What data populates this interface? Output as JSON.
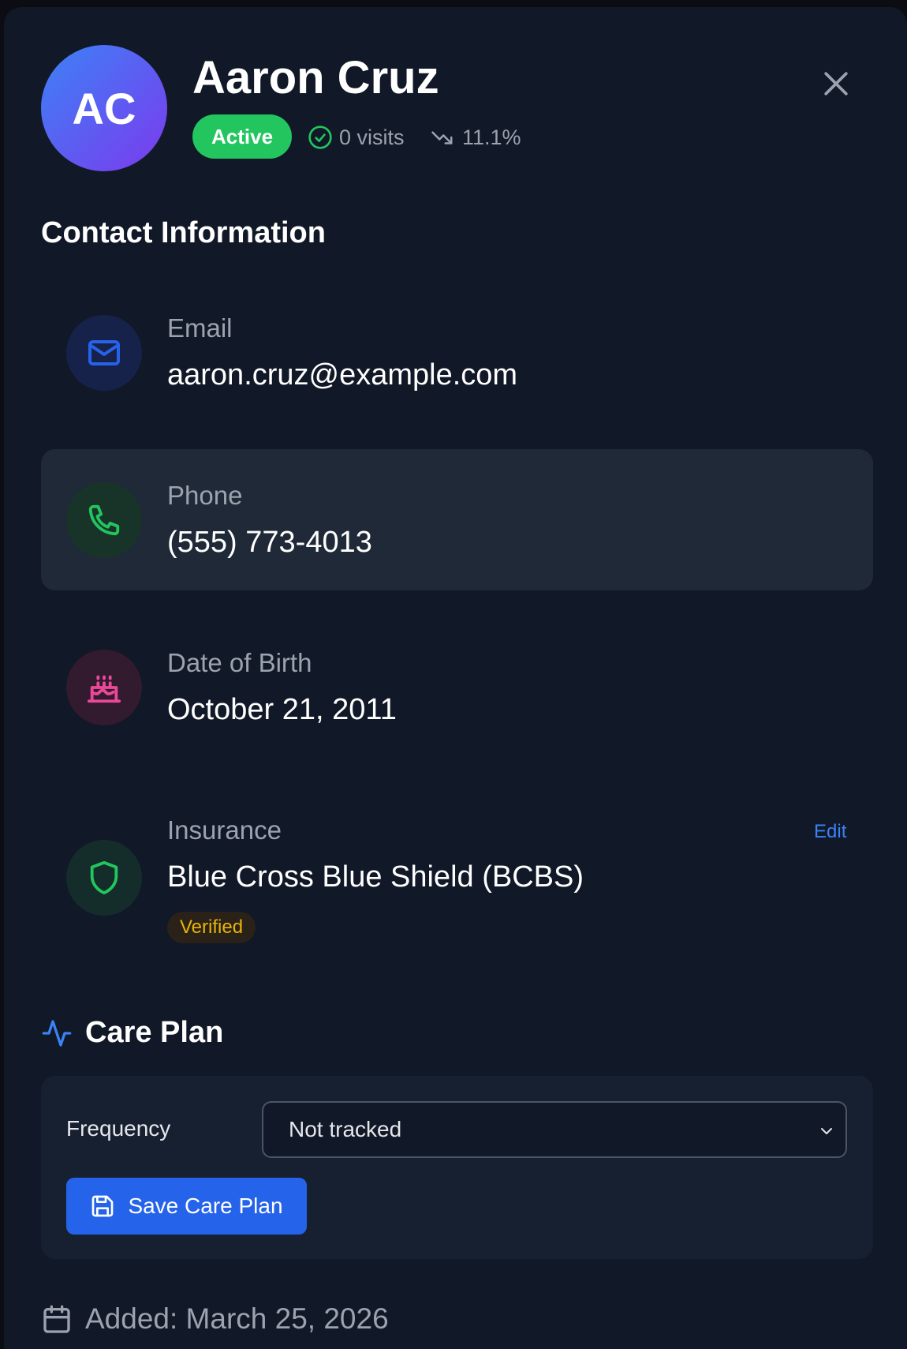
{
  "patient": {
    "initials": "AC",
    "name": "Aaron Cruz",
    "status": "Active",
    "visits": "0 visits",
    "trend": "11.1%"
  },
  "contact": {
    "title": "Contact Information",
    "email_label": "Email",
    "email_value": "aaron.cruz@example.com",
    "phone_label": "Phone",
    "phone_value": "(555) 773-4013",
    "dob_label": "Date of Birth",
    "dob_value": "October 21, 2011",
    "insurance_label": "Insurance",
    "insurance_value": "Blue Cross Blue Shield (BCBS)",
    "insurance_edit": "Edit",
    "insurance_status": "Verified"
  },
  "care_plan": {
    "title": "Care Plan",
    "frequency_label": "Frequency",
    "frequency_value": "Not tracked",
    "save_label": "Save Care Plan"
  },
  "footer": {
    "added": "Added: March 25, 2026"
  },
  "colors": {
    "panel_bg": "#111827",
    "accent_blue": "#2563eb",
    "status_green": "#22c55e",
    "verified_yellow": "#eab308",
    "birthday_pink": "#ec4899"
  },
  "icons": {
    "close": "close-icon",
    "visits": "check-circle-icon",
    "trend": "trending-down-icon",
    "email": "mail-icon",
    "phone": "phone-icon",
    "dob": "cake-icon",
    "insurance": "shield-icon",
    "care_plan": "activity-icon",
    "save": "save-icon",
    "added": "calendar-icon",
    "select": "chevron-down-icon"
  }
}
